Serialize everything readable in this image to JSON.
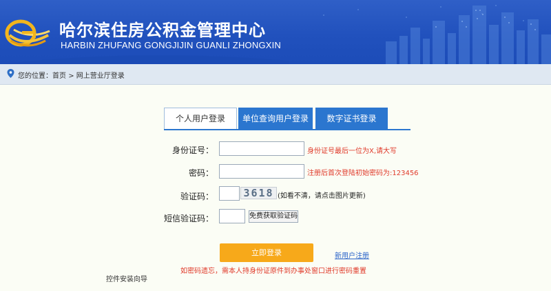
{
  "header": {
    "title": "哈尔滨住房公积金管理中心",
    "subtitle": "HARBIN ZHUFANG GONGJIJIN GUANLI ZHONGXIN",
    "logo_icon": "swirl-logo-icon"
  },
  "breadcrumb": {
    "prefix": "您的位置：",
    "home": "首页",
    "separator": ">",
    "current": "网上营业厅登录"
  },
  "tabs": [
    {
      "label": "个人用户登录",
      "active": true
    },
    {
      "label": "单位查询用户登录",
      "active": false
    },
    {
      "label": "数字证书登录",
      "active": false
    }
  ],
  "form": {
    "id_label": "身份证号：",
    "id_value": "",
    "id_hint": "身份证号最后一位为X,请大写",
    "password_label": "密码：",
    "password_value": "",
    "password_hint": "注册后首次登陆初始密码为:123456",
    "captcha_label": "验证码：",
    "captcha_value": "",
    "captcha_image_text": "3618",
    "captcha_note": "(如看不清，请点击图片更新)",
    "sms_label": "短信验证码：",
    "sms_value": "",
    "sms_button": "免费获取验证码"
  },
  "actions": {
    "login_button": "立即登录",
    "register_link": "新用户注册"
  },
  "footer": {
    "warning": "如密码遗忘，需本人持身份证原件到办事处窗口进行密码重置",
    "install_guide": "控件安装向导"
  },
  "colors": {
    "banner": "#2151bd",
    "tab_blue": "#2b76cf",
    "login_orange": "#f7a91a",
    "hint_red": "#e03a2a",
    "link_blue": "#2b64c9"
  }
}
